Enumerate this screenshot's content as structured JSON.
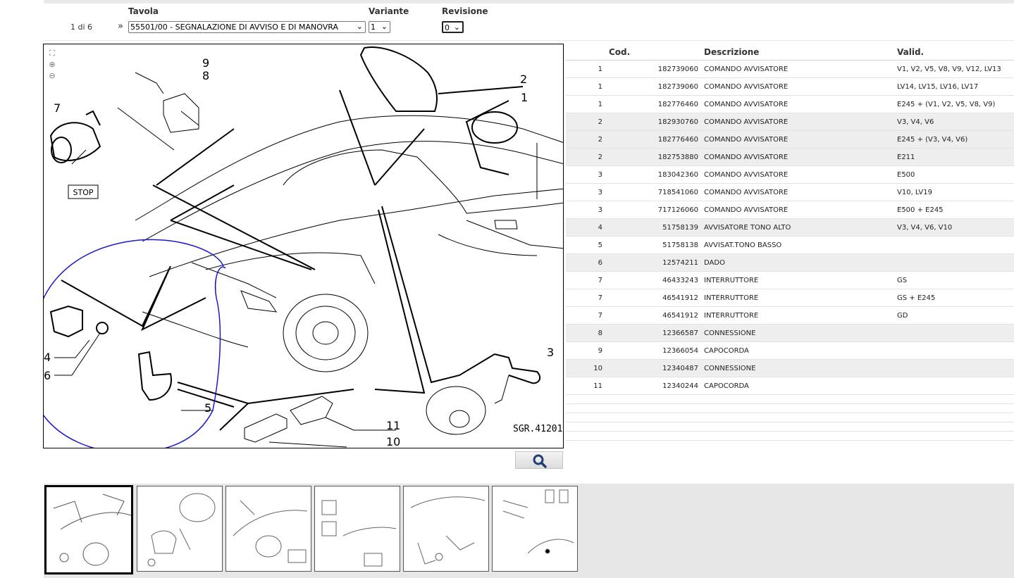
{
  "header": {
    "tavola_label": "Tavola",
    "variante_label": "Variante",
    "revisione_label": "Revisione",
    "pager_text": "1 di 6",
    "pager_icon": "double-chevron-right-icon",
    "tavola_value": "55501/00 - SEGNALAZIONE DI AVVISO E DI MANOVRA",
    "variante_value": "1",
    "revisione_value": "0"
  },
  "drawing": {
    "code": "SGR.41201",
    "stop_label": "STOP",
    "callouts": [
      "1",
      "2",
      "3",
      "4",
      "5",
      "6",
      "7",
      "8",
      "9",
      "10",
      "11"
    ],
    "annotation_color": "#1a1acc"
  },
  "search_button": {
    "icon": "magnifier-icon",
    "color": "#1f3f73"
  },
  "parts_table": {
    "columns": {
      "cod": "Cod.",
      "descrizione": "Descrizione",
      "valid": "Valid."
    },
    "rows": [
      {
        "pos": "1",
        "code": "182739060",
        "desc": "COMANDO AVVISATORE",
        "valid": "V1, V2, V5, V8, V9, V12, LV13",
        "alt": false
      },
      {
        "pos": "1",
        "code": "182739060",
        "desc": "COMANDO AVVISATORE",
        "valid": "LV14, LV15, LV16, LV17",
        "alt": false
      },
      {
        "pos": "1",
        "code": "182776460",
        "desc": "COMANDO AVVISATORE",
        "valid": "E245 + (V1, V2, V5, V8, V9)",
        "alt": false
      },
      {
        "pos": "2",
        "code": "182930760",
        "desc": "COMANDO AVVISATORE",
        "valid": "V3, V4, V6",
        "alt": true
      },
      {
        "pos": "2",
        "code": "182776460",
        "desc": "COMANDO AVVISATORE",
        "valid": "E245 + (V3, V4, V6)",
        "alt": true
      },
      {
        "pos": "2",
        "code": "182753880",
        "desc": "COMANDO AVVISATORE",
        "valid": "E211",
        "alt": true
      },
      {
        "pos": "3",
        "code": "183042360",
        "desc": "COMANDO AVVISATORE",
        "valid": "E500",
        "alt": false
      },
      {
        "pos": "3",
        "code": "718541060",
        "desc": "COMANDO AVVISATORE",
        "valid": "V10, LV19",
        "alt": false
      },
      {
        "pos": "3",
        "code": "717126060",
        "desc": "COMANDO AVVISATORE",
        "valid": "E500 + E245",
        "alt": false
      },
      {
        "pos": "4",
        "code": "51758139",
        "desc": "AVVISATORE TONO ALTO",
        "valid": "V3, V4, V6, V10",
        "alt": true
      },
      {
        "pos": "5",
        "code": "51758138",
        "desc": "AVVISAT.TONO BASSO",
        "valid": "",
        "alt": false
      },
      {
        "pos": "6",
        "code": "12574211",
        "desc": "DADO",
        "valid": "",
        "alt": true
      },
      {
        "pos": "7",
        "code": "46433243",
        "desc": "INTERRUTTORE",
        "valid": "GS",
        "alt": false
      },
      {
        "pos": "7",
        "code": "46541912",
        "desc": "INTERRUTTORE",
        "valid": "GS + E245",
        "alt": false
      },
      {
        "pos": "7",
        "code": "46541912",
        "desc": "INTERRUTTORE",
        "valid": "GD",
        "alt": false
      },
      {
        "pos": "8",
        "code": "12366587",
        "desc": "CONNESSIONE",
        "valid": "",
        "alt": true
      },
      {
        "pos": "9",
        "code": "12366054",
        "desc": "CAPOCORDA",
        "valid": "",
        "alt": false
      },
      {
        "pos": "10",
        "code": "12340487",
        "desc": "CONNESSIONE",
        "valid": "",
        "alt": true
      },
      {
        "pos": "11",
        "code": "12340244",
        "desc": "CAPOCORDA",
        "valid": "",
        "alt": false
      }
    ]
  },
  "thumbnails": {
    "count": 6,
    "active_index": 0
  }
}
